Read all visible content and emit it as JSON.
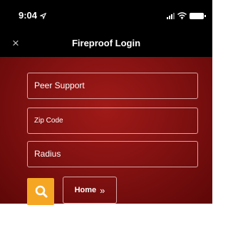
{
  "status_bar": {
    "time": "9:04",
    "location_icon": "location-arrow-icon",
    "icons": [
      "cellular-signal-icon",
      "wifi-icon",
      "battery-icon"
    ]
  },
  "nav": {
    "title": "Fireproof Login",
    "close_icon": "close-icon",
    "close_glyph": "×"
  },
  "form": {
    "fields": [
      {
        "value": "Peer Support"
      },
      {
        "value": "Zip Code"
      },
      {
        "value": "Radius"
      }
    ],
    "search_icon": "search-icon",
    "home_label": "Home",
    "home_icon": "double-chevron-right-icon",
    "home_glyph": "»"
  },
  "colors": {
    "accent": "#f5a623",
    "panel": "#8b1414",
    "bar": "#000000"
  }
}
